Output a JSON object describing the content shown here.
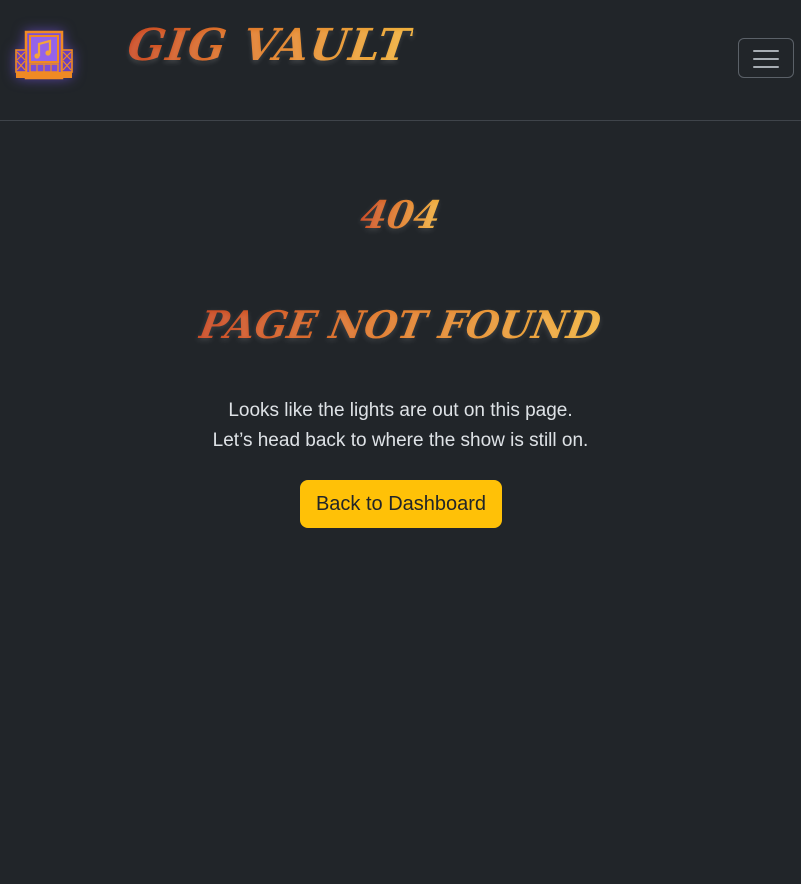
{
  "header": {
    "brand": "GIG VAULT",
    "logo_icon": "stage-speakers-music-icon",
    "menu_icon": "hamburger-menu-icon"
  },
  "error": {
    "code": "404",
    "title": "Page Not Found",
    "message_line1": "Looks like the lights are out on this page.",
    "message_line2": "Let’s head back to where the show is still on.",
    "button_label": "Back to Dashboard"
  },
  "colors": {
    "background": "#212529",
    "accent_button": "#ffc107",
    "title_gradient_start": "#c9461f",
    "title_gradient_end": "#f0b03a"
  }
}
